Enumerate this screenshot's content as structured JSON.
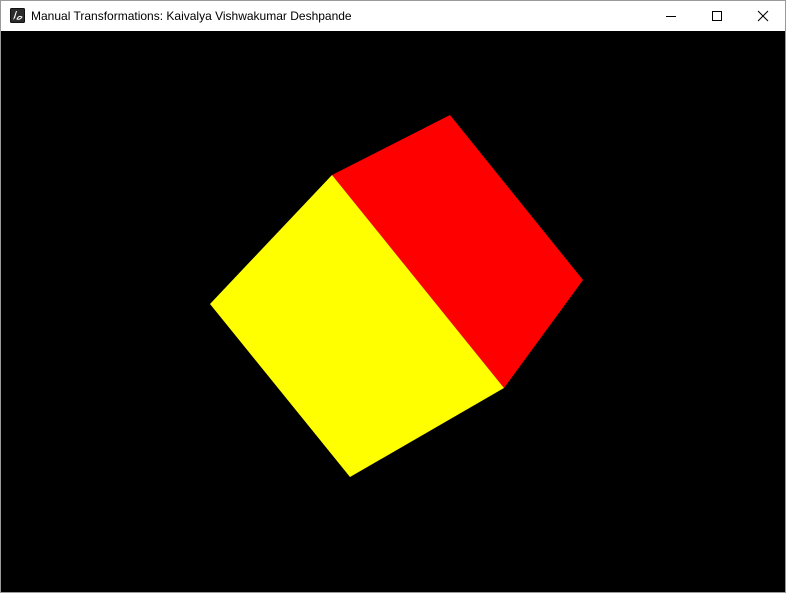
{
  "window": {
    "title": "Manual Transformations: Kaivalya Vishwakumar Deshpande",
    "app_icon": "opengl-app-icon",
    "controls": [
      "minimize-icon",
      "maximize-icon",
      "close-icon"
    ]
  },
  "viewport": {
    "background_color": "#000000",
    "shape": "cube",
    "faces": [
      {
        "name": "front-face",
        "color": "#ffff00"
      },
      {
        "name": "top-face",
        "color": "#ff0000"
      }
    ]
  }
}
